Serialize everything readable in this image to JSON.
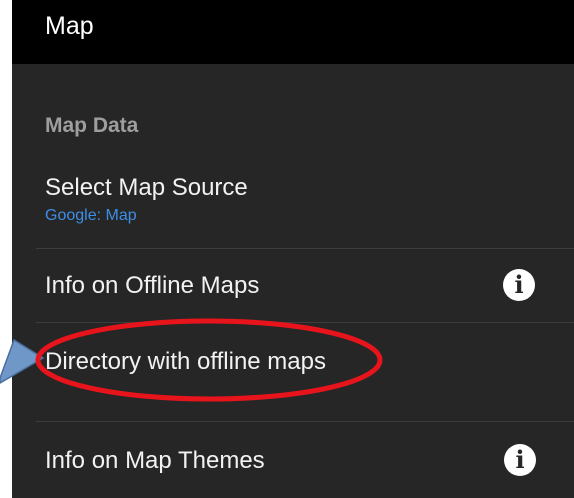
{
  "appbar": {
    "title": "Map"
  },
  "section": {
    "header": "Map Data"
  },
  "items": [
    {
      "title": "Select Map Source",
      "summary": "Google: Map",
      "icon": ""
    },
    {
      "title": "Info on Offline Maps",
      "summary": "",
      "icon": "info-icon"
    },
    {
      "title": "Directory with offline maps",
      "summary": "",
      "icon": ""
    },
    {
      "title": "Info on Map Themes",
      "summary": "",
      "icon": "info-icon"
    }
  ],
  "info_glyph": "i",
  "colors": {
    "appbar_bg": "#000000",
    "screen_bg": "#262626",
    "section_header": "#9e9e9e",
    "summary_text": "#3d8ee6",
    "highlight_ellipse": "#e8141c",
    "annotation_arrow": "#6f97c8"
  }
}
